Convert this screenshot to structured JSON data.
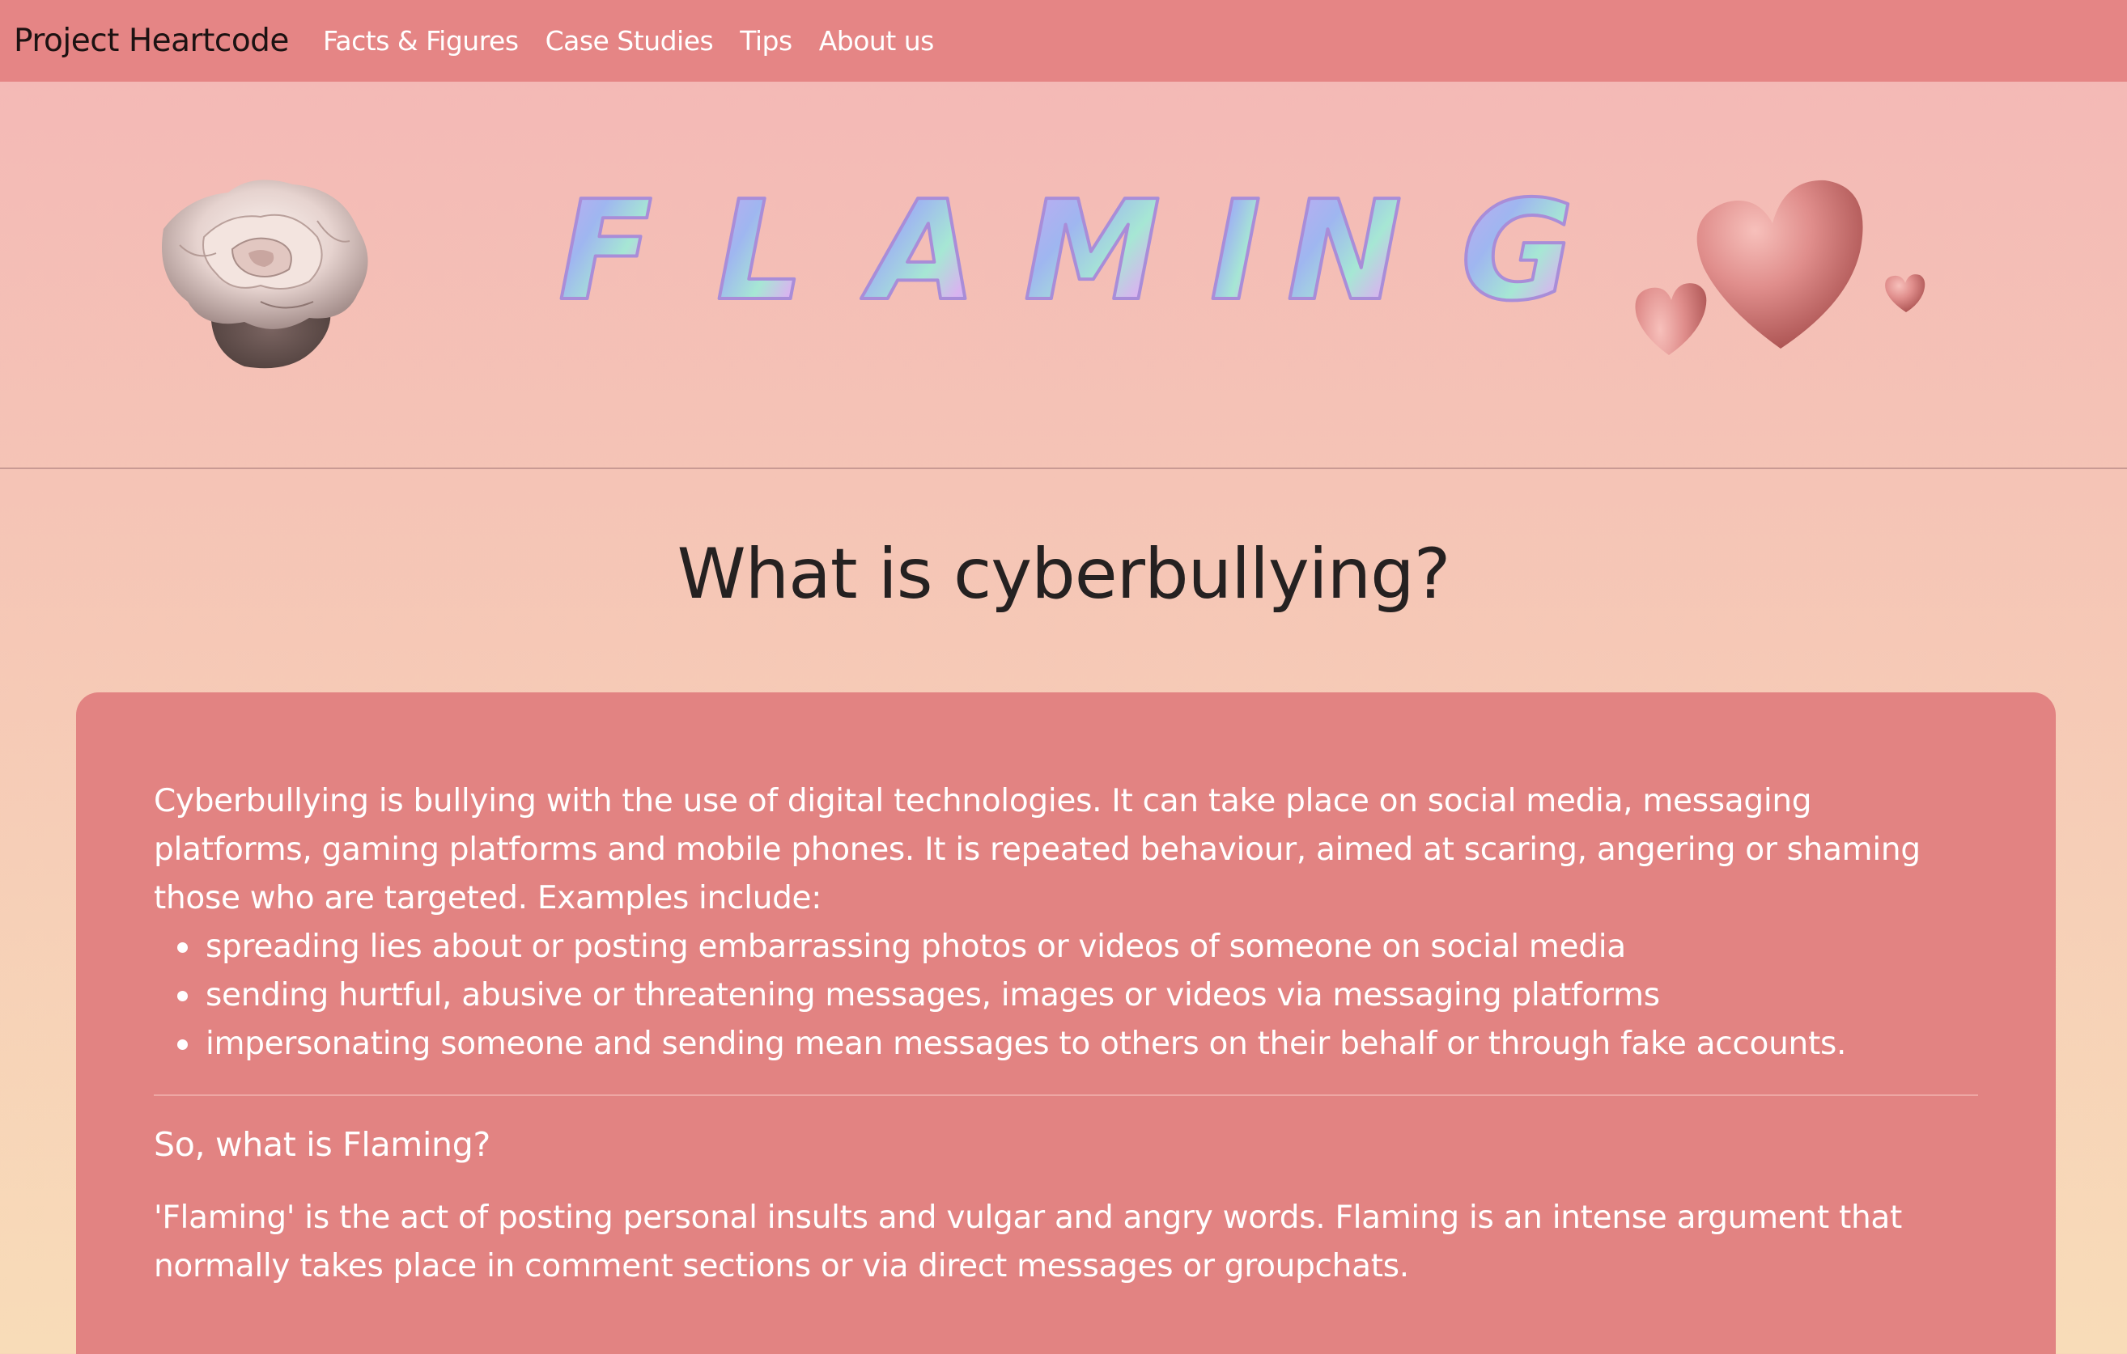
{
  "navbar": {
    "brand": "Project Heartcode",
    "links": [
      "Facts & Figures",
      "Case Studies",
      "Tips",
      "About us"
    ]
  },
  "hero": {
    "title_letters": [
      "F",
      "L",
      "A",
      "M",
      "I",
      "N",
      "G"
    ]
  },
  "main": {
    "heading": "What is cyberbullying?",
    "intro": "Cyberbullying is bullying with the use of digital technologies. It can take place on social media, messaging platforms, gaming platforms and mobile phones. It is repeated behaviour, aimed at scaring, angering or shaming those who are targeted. Examples include:",
    "examples": [
      "spreading lies about or posting embarrassing photos or videos of someone on social media",
      "sending hurtful, abusive or threatening messages, images or videos via messaging platforms",
      "impersonating someone and sending mean messages to others on their behalf or through fake accounts."
    ],
    "subheading": "So, what is Flaming?",
    "definition": "'Flaming' is the act of posting personal insults and vulgar and angry words. Flaming is an intense argument that normally takes place in comment sections or via direct messages or groupchats."
  },
  "colors": {
    "navbar": "#e58585",
    "card": "#e28382",
    "heading": "#252121",
    "card_text": "#ffffff"
  }
}
